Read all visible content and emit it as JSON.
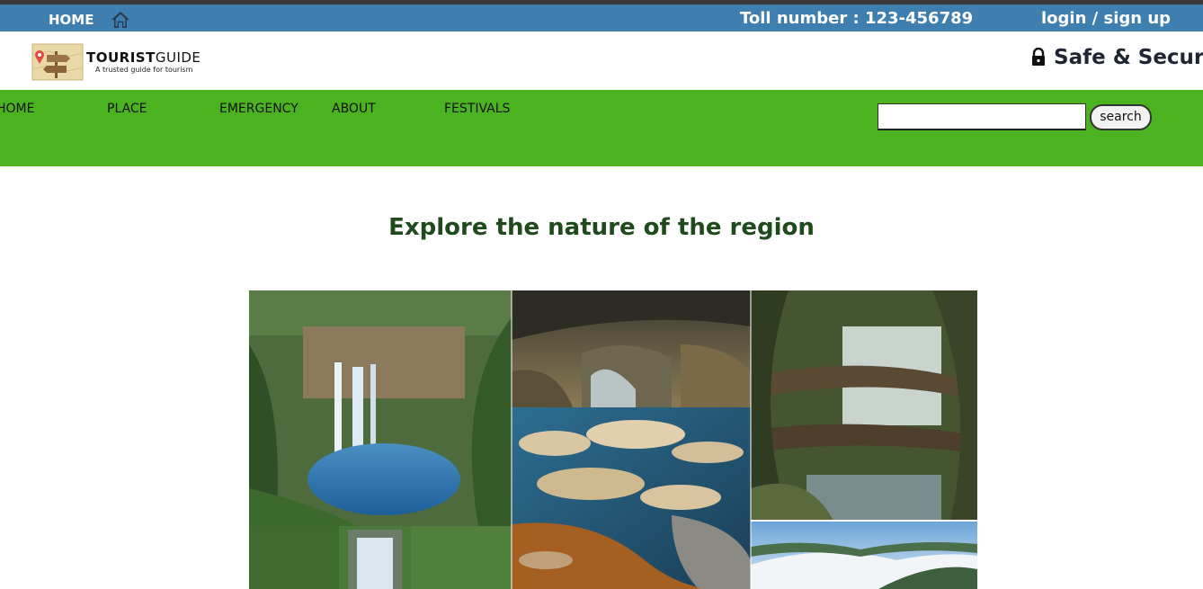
{
  "topbar": {
    "home_label": "HOME",
    "home_icon": "home-icon",
    "toll": "Toll number : 123-456789",
    "login": "login / sign up",
    "bg_color": "#3f7fb0"
  },
  "brand": {
    "logo_title_bold": "TOURIST",
    "logo_title_light": "GUIDE",
    "logo_tagline": "A trusted guide for tourism",
    "secure_text": "Safe & Secure",
    "secure_icon": "lock-icon"
  },
  "nav": {
    "bg_color": "#4bb31f",
    "items": [
      "HOME",
      "PLACE",
      "EMERGENCY",
      "ABOUT",
      "FESTIVALS"
    ],
    "search_placeholder": "",
    "search_button": "search"
  },
  "main": {
    "heading": "Explore the nature of the region",
    "heading_color": "#1f4a1b",
    "gallery": [
      "waterfall-photo",
      "cave-photo",
      "living-root-bridge-photo",
      "river-rocks-photo",
      "small-waterfall-photo",
      "cloudy-mountains-photo"
    ]
  }
}
